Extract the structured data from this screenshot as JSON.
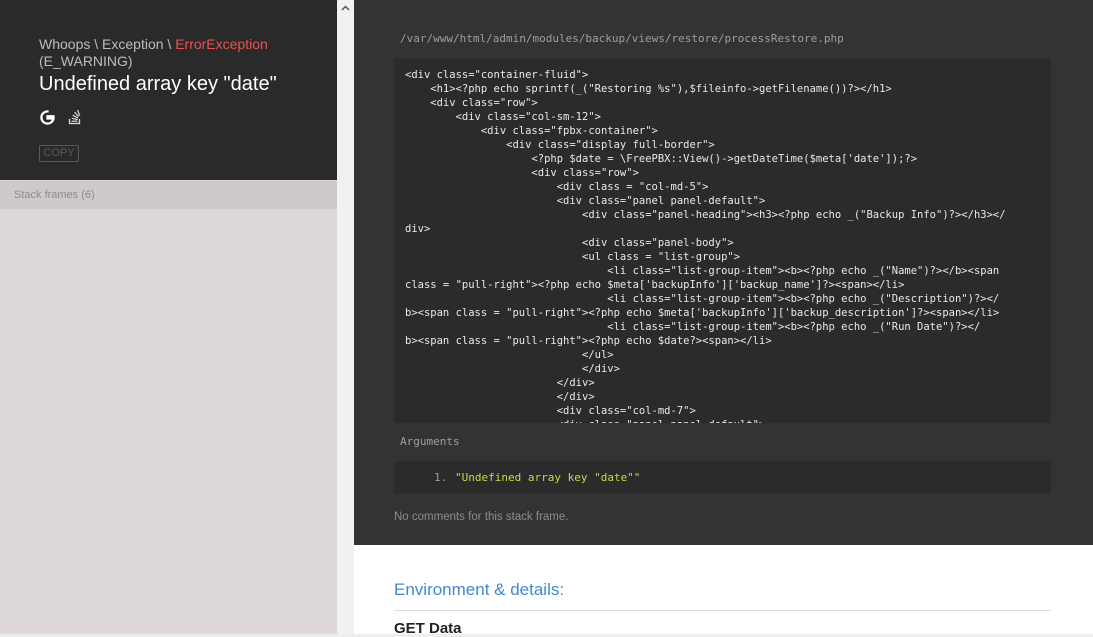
{
  "exception": {
    "path_prefix": "Whoops \\ Exception \\ ",
    "class": "ErrorException",
    "code": "(E_WARNING)",
    "message": "Undefined array key \"date\"",
    "search_links": [
      "google-icon",
      "stackoverflow-icon"
    ],
    "copy_label": "COPY"
  },
  "stack": {
    "frames_label": "Stack frames (6)"
  },
  "frame": {
    "file_path": "/var/www/html/admin/modules/backup/views/restore/processRestore.php",
    "code_lines": [
      "<div class=\"container-fluid\">",
      "    <h1><?php echo sprintf(_(\"Restoring %s\"),$fileinfo->getFilename())?></h1>",
      "    <div class=\"row\">",
      "        <div class=\"col-sm-12\">",
      "            <div class=\"fpbx-container\">",
      "                <div class=\"display full-border\">",
      "                    <?php $date = \\FreePBX::View()->getDateTime($meta['date']);?>",
      "                    <div class=\"row\">",
      "                        <div class = \"col-md-5\">",
      "                        <div class=\"panel panel-default\">",
      "                            <div class=\"panel-heading\"><h3><?php echo _(\"Backup Info\")?></h3></",
      "div>",
      "                            <div class=\"panel-body\">",
      "                            <ul class = \"list-group\">",
      "                                <li class=\"list-group-item\"><b><?php echo _(\"Name\")?></b><span",
      "class = \"pull-right\"><?php echo $meta['backupInfo']['backup_name']?><span></li>",
      "                                <li class=\"list-group-item\"><b><?php echo _(\"Description\")?></",
      "b><span class = \"pull-right\"><?php echo $meta['backupInfo']['backup_description']?><span></li>",
      "                                <li class=\"list-group-item\"><b><?php echo _(\"Run Date\")?></",
      "b><span class = \"pull-right\"><?php echo $date?><span></li>",
      "                            </ul>",
      "                            </div>",
      "                        </div>",
      "                        </div>",
      "                        <div class=\"col-md-7\">",
      "                        <div class=\"panel panel-default\">"
    ],
    "arguments_title": "Arguments",
    "arguments": [
      {
        "index": "1.",
        "value": "\"Undefined array key \"date\"\""
      }
    ],
    "no_comments": "No comments for this stack frame."
  },
  "environment": {
    "title": "Environment & details:",
    "first_section": "GET Data"
  },
  "colors": {
    "error_class": "#e95353",
    "accent_link": "#4288ce",
    "string_literal": "#c7d94b"
  }
}
